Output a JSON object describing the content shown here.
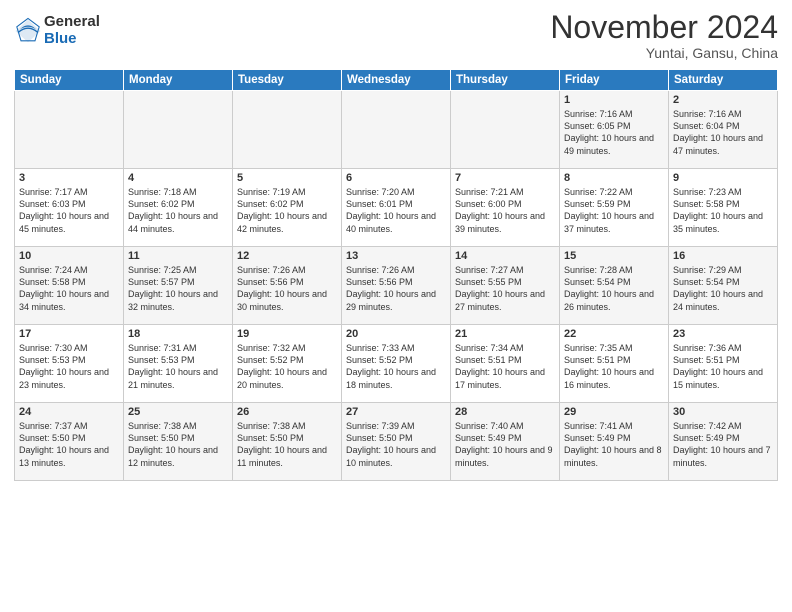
{
  "header": {
    "logo_general": "General",
    "logo_blue": "Blue",
    "month": "November 2024",
    "location": "Yuntai, Gansu, China"
  },
  "days_of_week": [
    "Sunday",
    "Monday",
    "Tuesday",
    "Wednesday",
    "Thursday",
    "Friday",
    "Saturday"
  ],
  "weeks": [
    [
      {
        "day": "",
        "info": ""
      },
      {
        "day": "",
        "info": ""
      },
      {
        "day": "",
        "info": ""
      },
      {
        "day": "",
        "info": ""
      },
      {
        "day": "",
        "info": ""
      },
      {
        "day": "1",
        "info": "Sunrise: 7:16 AM\nSunset: 6:05 PM\nDaylight: 10 hours\nand 49 minutes."
      },
      {
        "day": "2",
        "info": "Sunrise: 7:16 AM\nSunset: 6:04 PM\nDaylight: 10 hours\nand 47 minutes."
      }
    ],
    [
      {
        "day": "3",
        "info": "Sunrise: 7:17 AM\nSunset: 6:03 PM\nDaylight: 10 hours\nand 45 minutes."
      },
      {
        "day": "4",
        "info": "Sunrise: 7:18 AM\nSunset: 6:02 PM\nDaylight: 10 hours\nand 44 minutes."
      },
      {
        "day": "5",
        "info": "Sunrise: 7:19 AM\nSunset: 6:02 PM\nDaylight: 10 hours\nand 42 minutes."
      },
      {
        "day": "6",
        "info": "Sunrise: 7:20 AM\nSunset: 6:01 PM\nDaylight: 10 hours\nand 40 minutes."
      },
      {
        "day": "7",
        "info": "Sunrise: 7:21 AM\nSunset: 6:00 PM\nDaylight: 10 hours\nand 39 minutes."
      },
      {
        "day": "8",
        "info": "Sunrise: 7:22 AM\nSunset: 5:59 PM\nDaylight: 10 hours\nand 37 minutes."
      },
      {
        "day": "9",
        "info": "Sunrise: 7:23 AM\nSunset: 5:58 PM\nDaylight: 10 hours\nand 35 minutes."
      }
    ],
    [
      {
        "day": "10",
        "info": "Sunrise: 7:24 AM\nSunset: 5:58 PM\nDaylight: 10 hours\nand 34 minutes."
      },
      {
        "day": "11",
        "info": "Sunrise: 7:25 AM\nSunset: 5:57 PM\nDaylight: 10 hours\nand 32 minutes."
      },
      {
        "day": "12",
        "info": "Sunrise: 7:26 AM\nSunset: 5:56 PM\nDaylight: 10 hours\nand 30 minutes."
      },
      {
        "day": "13",
        "info": "Sunrise: 7:26 AM\nSunset: 5:56 PM\nDaylight: 10 hours\nand 29 minutes."
      },
      {
        "day": "14",
        "info": "Sunrise: 7:27 AM\nSunset: 5:55 PM\nDaylight: 10 hours\nand 27 minutes."
      },
      {
        "day": "15",
        "info": "Sunrise: 7:28 AM\nSunset: 5:54 PM\nDaylight: 10 hours\nand 26 minutes."
      },
      {
        "day": "16",
        "info": "Sunrise: 7:29 AM\nSunset: 5:54 PM\nDaylight: 10 hours\nand 24 minutes."
      }
    ],
    [
      {
        "day": "17",
        "info": "Sunrise: 7:30 AM\nSunset: 5:53 PM\nDaylight: 10 hours\nand 23 minutes."
      },
      {
        "day": "18",
        "info": "Sunrise: 7:31 AM\nSunset: 5:53 PM\nDaylight: 10 hours\nand 21 minutes."
      },
      {
        "day": "19",
        "info": "Sunrise: 7:32 AM\nSunset: 5:52 PM\nDaylight: 10 hours\nand 20 minutes."
      },
      {
        "day": "20",
        "info": "Sunrise: 7:33 AM\nSunset: 5:52 PM\nDaylight: 10 hours\nand 18 minutes."
      },
      {
        "day": "21",
        "info": "Sunrise: 7:34 AM\nSunset: 5:51 PM\nDaylight: 10 hours\nand 17 minutes."
      },
      {
        "day": "22",
        "info": "Sunrise: 7:35 AM\nSunset: 5:51 PM\nDaylight: 10 hours\nand 16 minutes."
      },
      {
        "day": "23",
        "info": "Sunrise: 7:36 AM\nSunset: 5:51 PM\nDaylight: 10 hours\nand 15 minutes."
      }
    ],
    [
      {
        "day": "24",
        "info": "Sunrise: 7:37 AM\nSunset: 5:50 PM\nDaylight: 10 hours\nand 13 minutes."
      },
      {
        "day": "25",
        "info": "Sunrise: 7:38 AM\nSunset: 5:50 PM\nDaylight: 10 hours\nand 12 minutes."
      },
      {
        "day": "26",
        "info": "Sunrise: 7:38 AM\nSunset: 5:50 PM\nDaylight: 10 hours\nand 11 minutes."
      },
      {
        "day": "27",
        "info": "Sunrise: 7:39 AM\nSunset: 5:50 PM\nDaylight: 10 hours\nand 10 minutes."
      },
      {
        "day": "28",
        "info": "Sunrise: 7:40 AM\nSunset: 5:49 PM\nDaylight: 10 hours\nand 9 minutes."
      },
      {
        "day": "29",
        "info": "Sunrise: 7:41 AM\nSunset: 5:49 PM\nDaylight: 10 hours\nand 8 minutes."
      },
      {
        "day": "30",
        "info": "Sunrise: 7:42 AM\nSunset: 5:49 PM\nDaylight: 10 hours\nand 7 minutes."
      }
    ]
  ]
}
